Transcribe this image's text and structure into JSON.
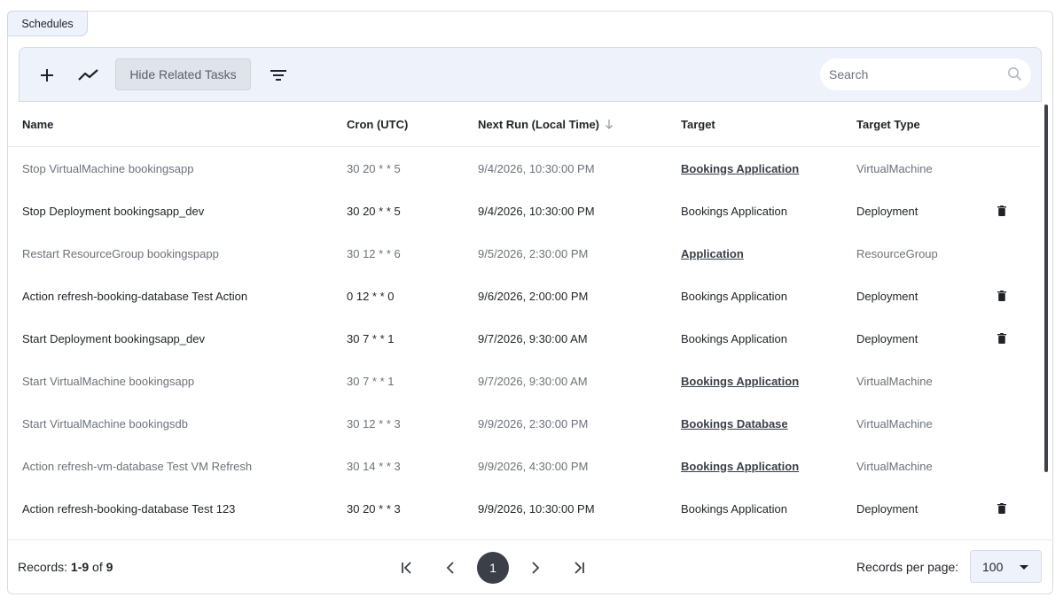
{
  "tab": {
    "label": "Schedules"
  },
  "toolbar": {
    "add_icon": "plus-icon",
    "chart_icon": "trend-line-icon",
    "hide_related_label": "Hide Related Tasks",
    "filter_icon": "filter-lines-icon",
    "search_placeholder": "Search",
    "search_value": ""
  },
  "table": {
    "columns": [
      "Name",
      "Cron (UTC)",
      "Next Run (Local Time)",
      "Target",
      "Target Type"
    ],
    "sort_column": "Next Run (Local Time)",
    "sort_direction": "descending-arrow",
    "rows": [
      {
        "name": "Stop VirtualMachine bookingsapp",
        "cron": "30 20 * * 5",
        "next_run": "9/4/2026, 10:30:00 PM",
        "target": "Bookings Application",
        "target_type": "VirtualMachine",
        "dim": true,
        "target_link": true,
        "deletable": false
      },
      {
        "name": "Stop Deployment bookingsapp_dev",
        "cron": "30 20 * * 5",
        "next_run": "9/4/2026, 10:30:00 PM",
        "target": "Bookings Application",
        "target_type": "Deployment",
        "dim": false,
        "target_link": false,
        "deletable": true
      },
      {
        "name": "Restart ResourceGroup bookingspapp",
        "cron": "30 12 * * 6",
        "next_run": "9/5/2026, 2:30:00 PM",
        "target": "Application",
        "target_type": "ResourceGroup",
        "dim": true,
        "target_link": true,
        "deletable": false
      },
      {
        "name": "Action refresh-booking-database Test Action",
        "cron": "0 12 * * 0",
        "next_run": "9/6/2026, 2:00:00 PM",
        "target": "Bookings Application",
        "target_type": "Deployment",
        "dim": false,
        "target_link": false,
        "deletable": true
      },
      {
        "name": "Start Deployment bookingsapp_dev",
        "cron": "30 7 * * 1",
        "next_run": "9/7/2026, 9:30:00 AM",
        "target": "Bookings Application",
        "target_type": "Deployment",
        "dim": false,
        "target_link": false,
        "deletable": true
      },
      {
        "name": "Start VirtualMachine bookingsapp",
        "cron": "30 7 * * 1",
        "next_run": "9/7/2026, 9:30:00 AM",
        "target": "Bookings Application",
        "target_type": "VirtualMachine",
        "dim": true,
        "target_link": true,
        "deletable": false
      },
      {
        "name": "Start VirtualMachine bookingsdb",
        "cron": "30 12 * * 3",
        "next_run": "9/9/2026, 2:30:00 PM",
        "target": "Bookings Database",
        "target_type": "VirtualMachine",
        "dim": true,
        "target_link": true,
        "deletable": false
      },
      {
        "name": "Action refresh-vm-database Test VM Refresh",
        "cron": "30 14 * * 3",
        "next_run": "9/9/2026, 4:30:00 PM",
        "target": "Bookings Application",
        "target_type": "VirtualMachine",
        "dim": true,
        "target_link": true,
        "deletable": false
      },
      {
        "name": "Action refresh-booking-database Test 123",
        "cron": "30 20 * * 3",
        "next_run": "9/9/2026, 10:30:00 PM",
        "target": "Bookings Application",
        "target_type": "Deployment",
        "dim": false,
        "target_link": false,
        "deletable": true
      }
    ]
  },
  "footer": {
    "records_prefix": "Records: ",
    "records_range": "1-9",
    "records_of": " of ",
    "records_total": "9",
    "current_page": "1",
    "rpp_label": "Records per page:",
    "rpp_value": "100"
  },
  "colors": {
    "accent_bg": "#eef2fa",
    "page_current": "#3b3f47",
    "dim_text": "#6c727a"
  }
}
